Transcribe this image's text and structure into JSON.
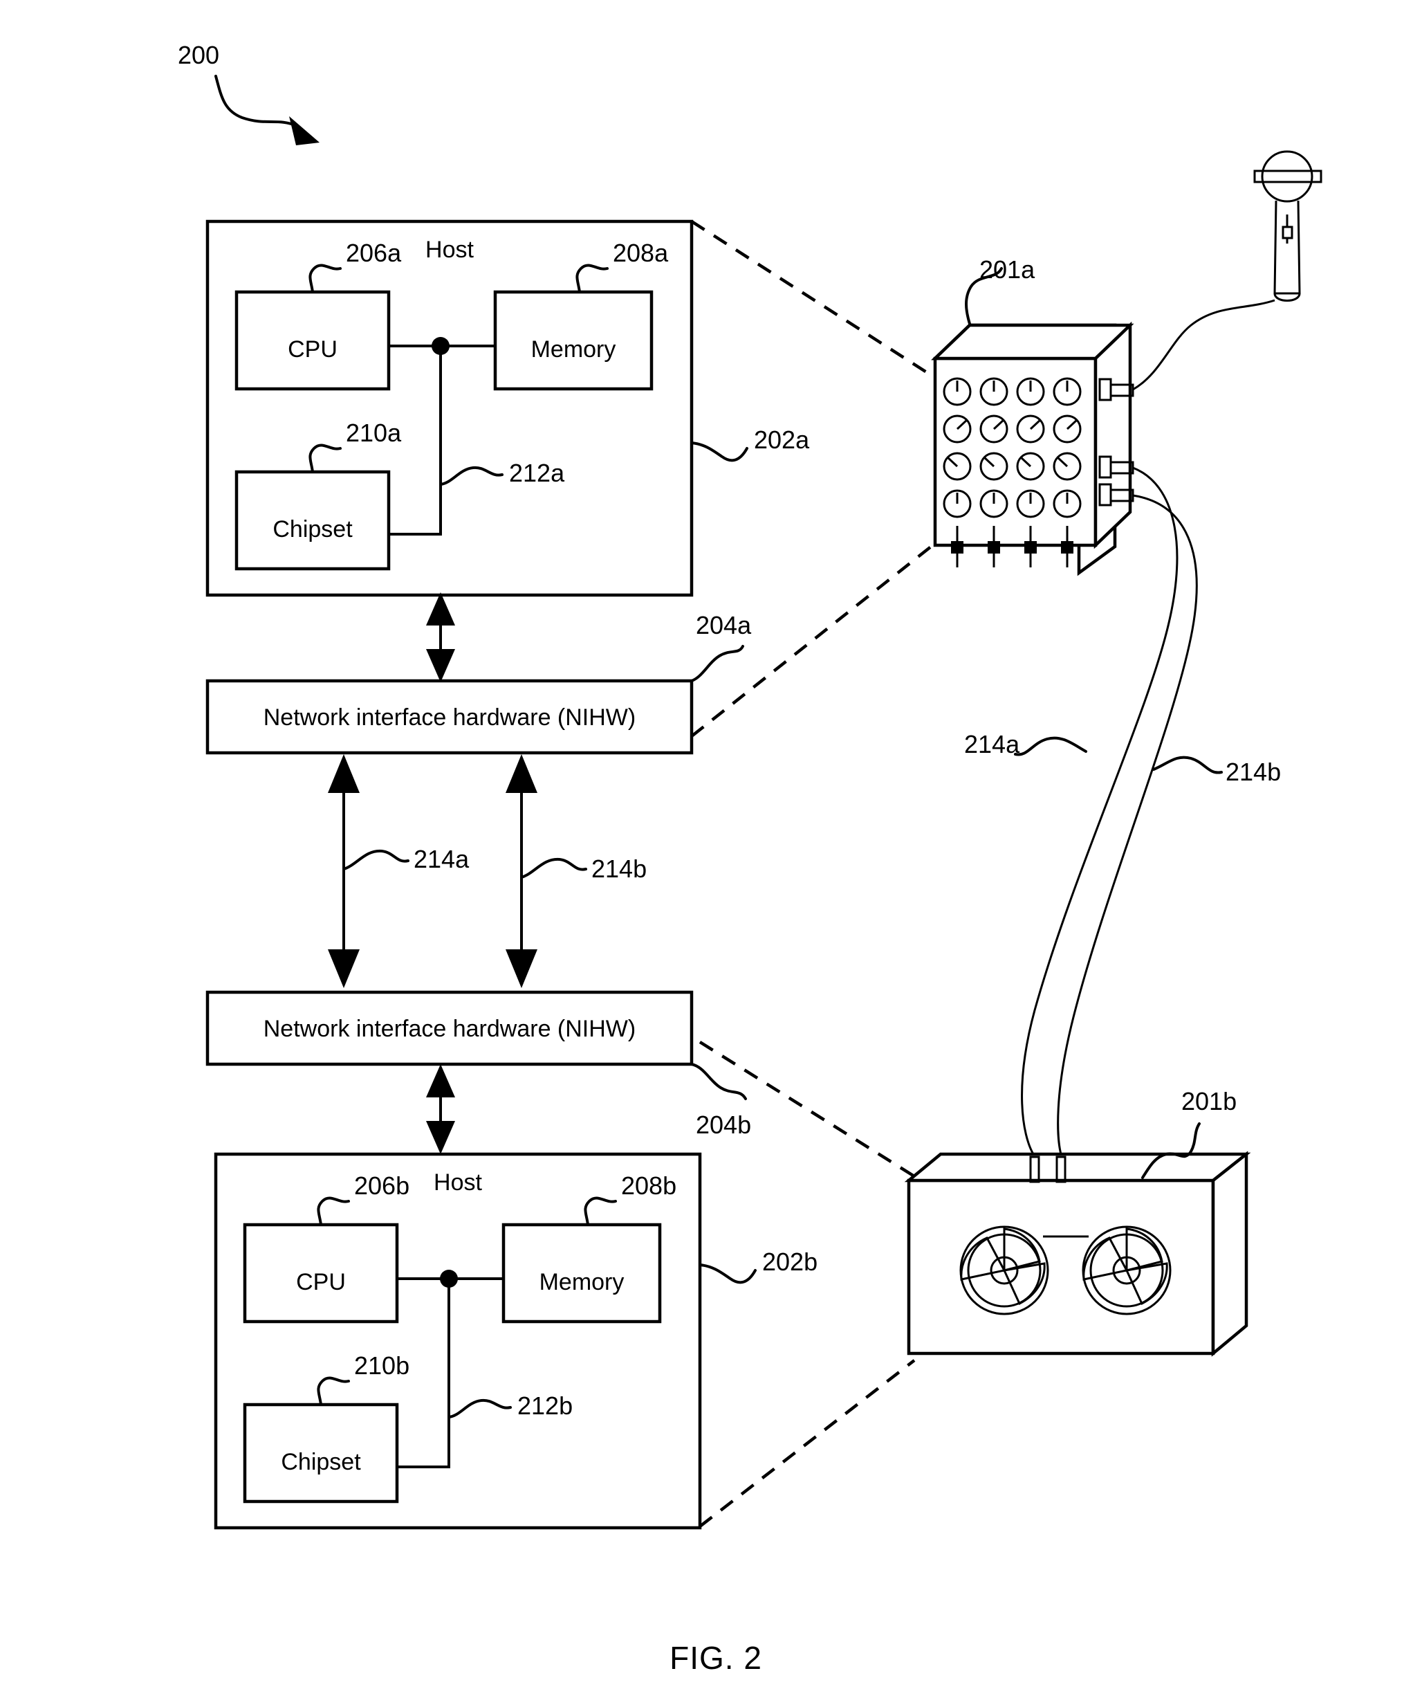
{
  "figure": {
    "caption": "FIG. 2",
    "system_ref": "200"
  },
  "host_a": {
    "title": "Host",
    "ref": "202a",
    "cpu": {
      "label": "CPU",
      "ref": "206a"
    },
    "memory": {
      "label": "Memory",
      "ref": "208a"
    },
    "chipset": {
      "label": "Chipset",
      "ref": "210a"
    },
    "bus_ref": "212a"
  },
  "nihw_a": {
    "label": "Network interface hardware (NIHW)",
    "ref": "204a"
  },
  "links": {
    "link_a": "214a",
    "link_b": "214b"
  },
  "nihw_b": {
    "label": "Network interface hardware (NIHW)",
    "ref": "204b"
  },
  "host_b": {
    "title": "Host",
    "ref": "202b",
    "cpu": {
      "label": "CPU",
      "ref": "206b"
    },
    "memory": {
      "label": "Memory",
      "ref": "208b"
    },
    "chipset": {
      "label": "Chipset",
      "ref": "210b"
    },
    "bus_ref": "212b"
  },
  "devices": {
    "mixer": {
      "ref": "201a",
      "knob_rows": 4,
      "knob_cols": 4,
      "slider_count": 4
    },
    "speaker": {
      "ref": "201b",
      "cone_count": 2
    },
    "cable_a_ref": "214a",
    "cable_b_ref": "214b"
  }
}
